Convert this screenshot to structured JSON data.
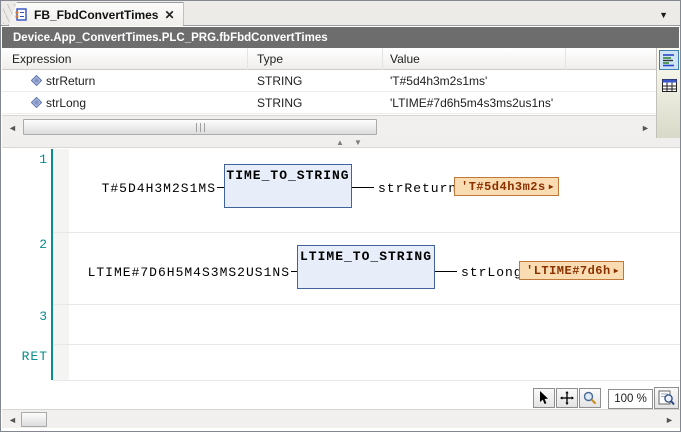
{
  "tab": {
    "title": "FB_FbdConvertTimes",
    "close_glyph": "✕",
    "dropdown_glyph": "▼"
  },
  "breadcrumb": "Device.App_ConvertTimes.PLC_PRG.fbFbdConvertTimes",
  "watch_table": {
    "columns": {
      "expression": "Expression",
      "type": "Type",
      "value": "Value"
    },
    "rows": [
      {
        "expression": "strReturn",
        "type": "STRING",
        "value": "'T#5d4h3m2s1ms'"
      },
      {
        "expression": "strLong",
        "type": "STRING",
        "value": "'LTIME#7d6h5m4s3ms2us1ns'"
      }
    ]
  },
  "networks": [
    {
      "label": "1",
      "input": "T#5D4H3M2S1MS",
      "block": "TIME_TO_STRING",
      "output": "strReturn",
      "value": "'T#5d4h3m2s",
      "arrow": "▶"
    },
    {
      "label": "2",
      "input": "LTIME#7D6H5M4S3MS2US1NS",
      "block": "LTIME_TO_STRING",
      "output": "strLong",
      "value": "'LTIME#7d6h",
      "arrow": "▶"
    },
    {
      "label": "3"
    },
    {
      "label": "RET"
    }
  ],
  "scrollbars": {
    "left_glyph": "◄",
    "right_glyph": "►",
    "up_glyph": "▲",
    "down_glyph": "▼"
  },
  "statusbar": {
    "zoom_level": "100 %"
  },
  "icons": {
    "tab_icon": "function-block-pou",
    "variable_icon": "variable-diamond",
    "declaration_view_icon": "declaration-view",
    "table_view_icon": "table-view",
    "select_tool_icon": "cursor-arrow",
    "pan_tool_icon": "pan-crosshair",
    "magnify_tool_icon": "magnifier",
    "zoom_select_icon": "magnifier-page"
  },
  "colors": {
    "header_bg": "#6d6d6d",
    "network_accent": "#0a8d8d",
    "block_fill": "#e7eefa",
    "block_border": "#41639b",
    "badge_bg": "#f9dcb2",
    "badge_border": "#c0783a",
    "badge_text": "#8b3000"
  }
}
